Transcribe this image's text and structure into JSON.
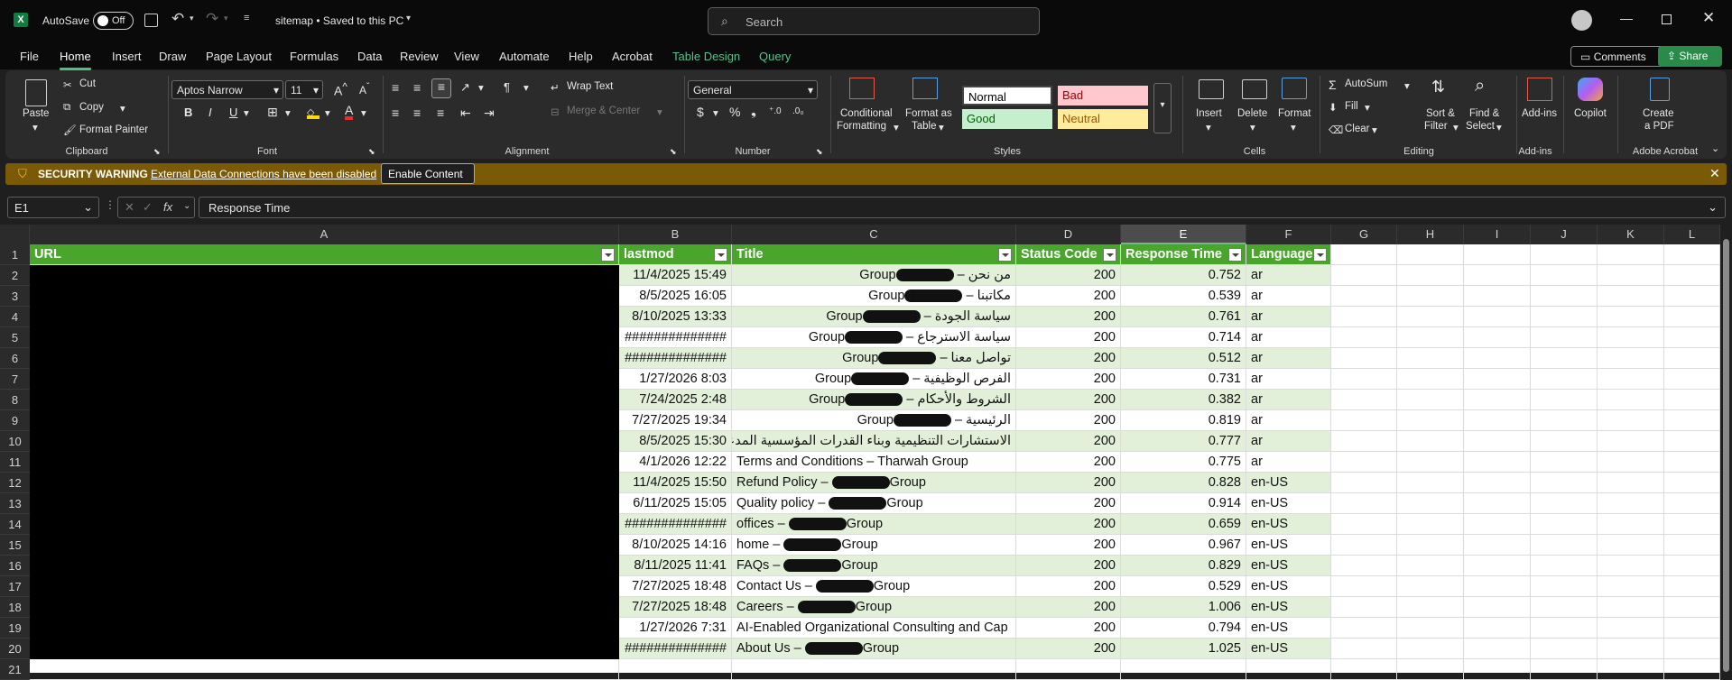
{
  "titlebar": {
    "autosave_label": "AutoSave",
    "autosave_state": "Off",
    "file_title": "sitemap • Saved to this PC",
    "search_placeholder": "Search"
  },
  "menu": {
    "tabs": [
      "File",
      "Home",
      "Insert",
      "Draw",
      "Page Layout",
      "Formulas",
      "Data",
      "Review",
      "View",
      "Automate",
      "Help",
      "Acrobat",
      "Table Design",
      "Query"
    ],
    "active": "Home",
    "comments_label": "Comments",
    "share_label": "Share"
  },
  "ribbon": {
    "clipboard": {
      "paste": "Paste",
      "cut": "Cut",
      "copy": "Copy",
      "format_painter": "Format Painter",
      "group": "Clipboard"
    },
    "font": {
      "name": "Aptos Narrow",
      "size": "11",
      "group": "Font"
    },
    "alignment": {
      "wrap_text": "Wrap Text",
      "merge_center": "Merge & Center",
      "group": "Alignment"
    },
    "number": {
      "format": "General",
      "group": "Number"
    },
    "styles": {
      "conditional": "Conditional",
      "conditional2": "Formatting",
      "format_as": "Format as",
      "format_as2": "Table",
      "normal": "Normal",
      "bad": "Bad",
      "good": "Good",
      "neutral": "Neutral",
      "group": "Styles"
    },
    "cells": {
      "insert": "Insert",
      "delete": "Delete",
      "format": "Format",
      "group": "Cells"
    },
    "editing": {
      "autosum": "AutoSum",
      "fill": "Fill",
      "clear": "Clear",
      "sort": "Sort &",
      "sort2": "Filter",
      "find": "Find &",
      "find2": "Select",
      "group": "Editing"
    },
    "addins": {
      "label": "Add-ins",
      "group": "Add-ins"
    },
    "copilot": {
      "label": "Copilot"
    },
    "acrobat": {
      "label": "Create",
      "label2": "a PDF",
      "group": "Adobe Acrobat"
    }
  },
  "security": {
    "title": "SECURITY WARNING",
    "message": "External Data Connections have been disabled",
    "button": "Enable Content"
  },
  "formula_bar": {
    "name_box": "E1",
    "content": "Response Time"
  },
  "grid": {
    "columns": [
      "A",
      "B",
      "C",
      "D",
      "E",
      "F",
      "G",
      "H",
      "I",
      "J",
      "K",
      "L"
    ],
    "selected_column": "E",
    "headers": [
      "URL",
      "lastmod",
      "Title",
      "Status Code",
      "Response Time",
      "Language"
    ],
    "rows": [
      {
        "n": "2",
        "lastmod": "11/4/2025 15:49",
        "title": "من نحن – Group",
        "status": "200",
        "time": "0.752",
        "lang": "ar"
      },
      {
        "n": "3",
        "lastmod": "8/5/2025 16:05",
        "title": "مكاتبنا – Group",
        "status": "200",
        "time": "0.539",
        "lang": "ar"
      },
      {
        "n": "4",
        "lastmod": "8/10/2025 13:33",
        "title": "سياسة الجودة – Group",
        "status": "200",
        "time": "0.761",
        "lang": "ar"
      },
      {
        "n": "5",
        "lastmod": "##############",
        "title": "سياسة الاسترجاع – Group",
        "status": "200",
        "time": "0.714",
        "lang": "ar"
      },
      {
        "n": "6",
        "lastmod": "##############",
        "title": "تواصل معنا – Group",
        "status": "200",
        "time": "0.512",
        "lang": "ar"
      },
      {
        "n": "7",
        "lastmod": "1/27/2026 8:03",
        "title": "الفرص الوظيفية – Group",
        "status": "200",
        "time": "0.731",
        "lang": "ar"
      },
      {
        "n": "8",
        "lastmod": "7/24/2025 2:48",
        "title": "الشروط والأحكام – Group",
        "status": "200",
        "time": "0.382",
        "lang": "ar"
      },
      {
        "n": "9",
        "lastmod": "7/27/2025 19:34",
        "title": "الرئيسية – Group",
        "status": "200",
        "time": "0.819",
        "lang": "ar"
      },
      {
        "n": "10",
        "lastmod": "8/5/2025 15:30",
        "title": "الاستشارات التنظيمية وبناء القدرات المؤسسية المدعومة ب",
        "status": "200",
        "time": "0.777",
        "lang": "ar"
      },
      {
        "n": "11",
        "lastmod": "4/1/2026 12:22",
        "title": "Terms and Conditions – Tharwah Group",
        "status": "200",
        "time": "0.775",
        "lang": "ar"
      },
      {
        "n": "12",
        "lastmod": "11/4/2025 15:50",
        "title": "Refund Policy – Group",
        "status": "200",
        "time": "0.828",
        "lang": "en-US"
      },
      {
        "n": "13",
        "lastmod": "6/11/2025 15:05",
        "title": "Quality policy – Group",
        "status": "200",
        "time": "0.914",
        "lang": "en-US"
      },
      {
        "n": "14",
        "lastmod": "##############",
        "title": "offices – Group",
        "status": "200",
        "time": "0.659",
        "lang": "en-US"
      },
      {
        "n": "15",
        "lastmod": "8/10/2025 14:16",
        "title": "home – Group",
        "status": "200",
        "time": "0.967",
        "lang": "en-US"
      },
      {
        "n": "16",
        "lastmod": "8/11/2025 11:41",
        "title": "FAQs – Group",
        "status": "200",
        "time": "0.829",
        "lang": "en-US"
      },
      {
        "n": "17",
        "lastmod": "7/27/2025 18:48",
        "title": "Contact Us – Group",
        "status": "200",
        "time": "0.529",
        "lang": "en-US"
      },
      {
        "n": "18",
        "lastmod": "7/27/2025 18:48",
        "title": "Careers – Group",
        "status": "200",
        "time": "1.006",
        "lang": "en-US"
      },
      {
        "n": "19",
        "lastmod": "1/27/2026 7:31",
        "title": "AI-Enabled Organizational Consulting and Cap",
        "status": "200",
        "time": "0.794",
        "lang": "en-US"
      },
      {
        "n": "20",
        "lastmod": "##############",
        "title": "About Us – Group",
        "status": "200",
        "time": "1.025",
        "lang": "en-US"
      }
    ],
    "last_row": "21"
  }
}
